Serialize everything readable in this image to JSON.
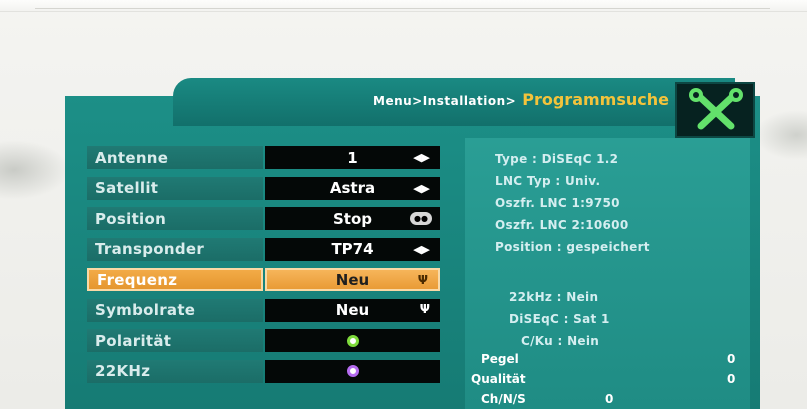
{
  "header": {
    "breadcrumb": "Menu>Installation>",
    "title": "Programmsuche"
  },
  "icon": "tools-icon",
  "menu": [
    {
      "label": "Antenne",
      "value": "1",
      "control": "arrows"
    },
    {
      "label": "Satellit",
      "value": "Astra",
      "control": "arrows"
    },
    {
      "label": "Position",
      "value": "Stop",
      "control": "pill"
    },
    {
      "label": "Transponder",
      "value": "TP74",
      "control": "arrows"
    },
    {
      "label": "Frequenz",
      "value": "Neu",
      "control": "fork",
      "active": true
    },
    {
      "label": "Symbolrate",
      "value": "Neu",
      "control": "fork"
    },
    {
      "label": "Polarität",
      "value": "",
      "control": "circle-green"
    },
    {
      "label": "22KHz",
      "value": "",
      "control": "circle-purple"
    }
  ],
  "info": {
    "type": "Type : DiSEqC 1.2",
    "lnc_typ": "LNC Typ : Univ.",
    "oszfr1": "Oszfr. LNC 1:9750",
    "oszfr2": "Oszfr. LNC 2:10600",
    "position": "Position : gespeichert",
    "khz": "22kHz : Nein",
    "diseqc": "DiSEqC : Sat 1",
    "cku": "C/Ku : Nein",
    "pegel_label": "Pegel",
    "pegel_value": "0",
    "qualitaet_label": "Qualität",
    "qualitaet_value": "0",
    "cutoff_label": "Ch/N/S",
    "cutoff_value": "0"
  },
  "colors": {
    "panel": "#1c8f87",
    "highlight": "#f2ab47",
    "title": "#f3c33b"
  }
}
